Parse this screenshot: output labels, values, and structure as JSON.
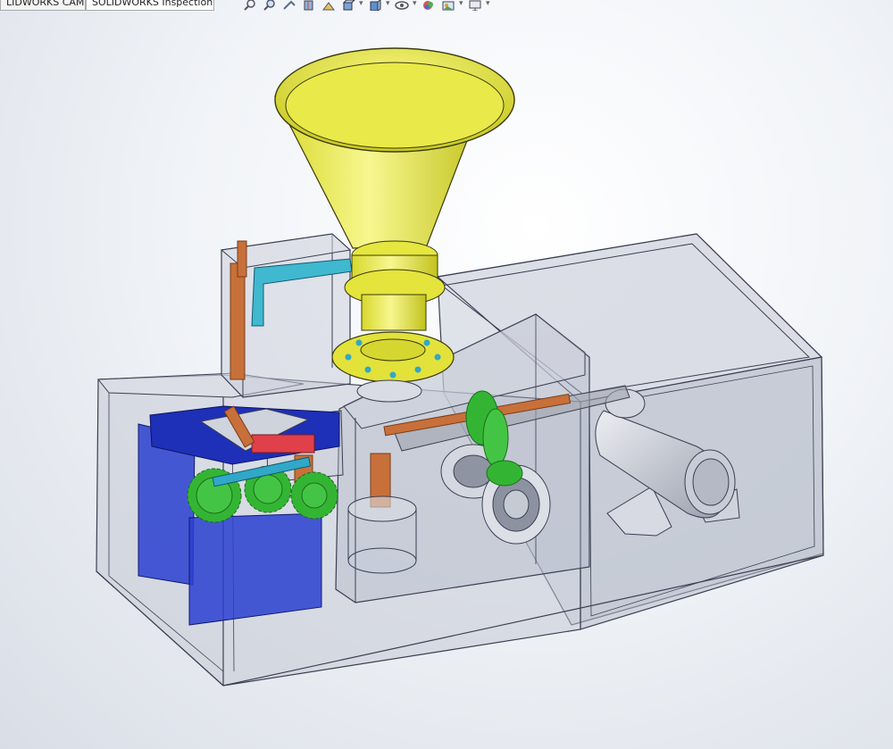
{
  "tabs": [
    {
      "label": "LIDWORKS CAM",
      "active": false
    },
    {
      "label": "SOLIDWORKS Inspection",
      "active": true
    }
  ],
  "heads_up_toolbar": [
    "zoom-to-fit-icon",
    "zoom-to-area-icon",
    "previous-view-icon",
    "section-view-icon",
    "dynamic-annotation-icon",
    "view-orientation-icon",
    "display-style-icon",
    "hide-show-items-icon",
    "edit-appearance-icon",
    "apply-scene-icon",
    "view-settings-icon"
  ],
  "colors": {
    "hopper": "#e8e83a",
    "housing_edge": "#3b3f52",
    "gear": "#33b533",
    "blue_panel": "#2a3fd0",
    "copper": "#c8703a",
    "cyan_arm": "#3fb8d0",
    "red_part": "#e0404a"
  }
}
